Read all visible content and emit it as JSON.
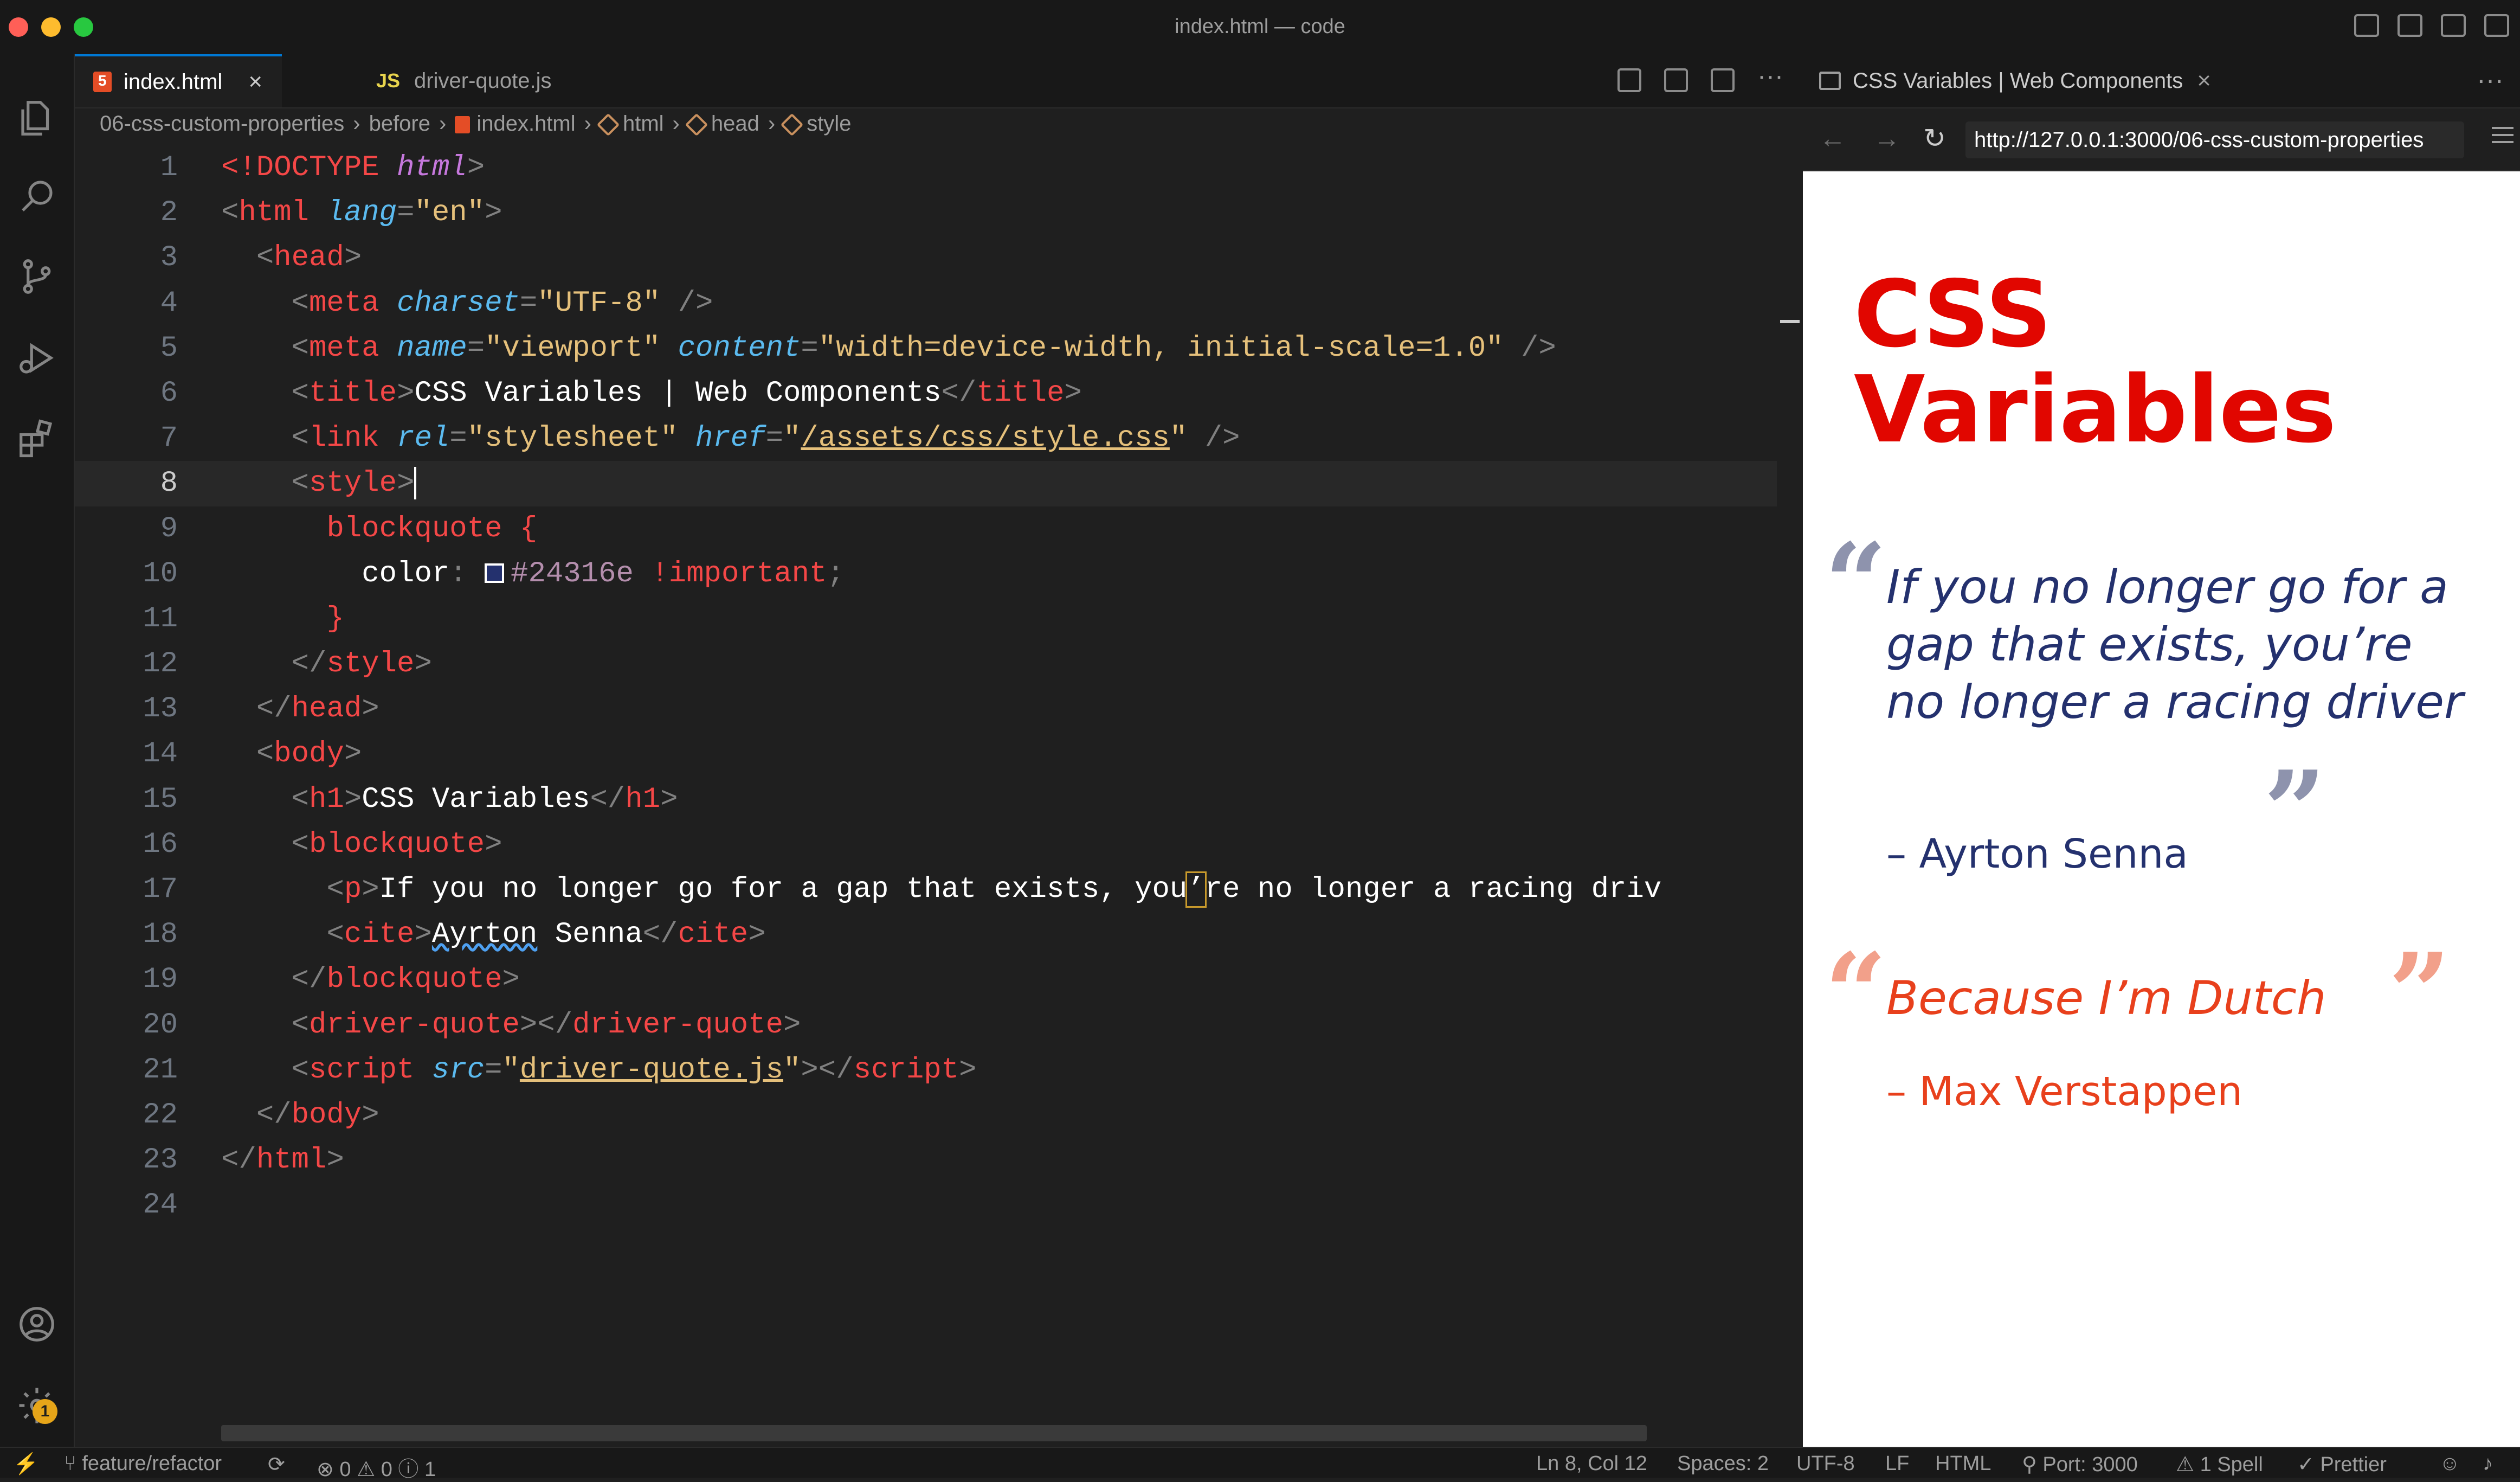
{
  "window": {
    "title": "index.html — code"
  },
  "editor": {
    "tabs": [
      {
        "label": "index.html",
        "type": "html",
        "active": true
      },
      {
        "label": "driver-quote.js",
        "type": "js",
        "icon_text": "JS",
        "active": false
      }
    ],
    "breadcrumb": [
      "06-css-custom-properties",
      "before",
      "index.html",
      "html",
      "head",
      "style"
    ],
    "line_numbers": [
      "1",
      "2",
      "3",
      "4",
      "5",
      "6",
      "7",
      "8",
      "9",
      "10",
      "11",
      "12",
      "13",
      "14",
      "15",
      "16",
      "17",
      "18",
      "19",
      "20",
      "21",
      "22",
      "23",
      "24"
    ],
    "current_line": "8",
    "code": {
      "l1_doctype": "<!DOCTYPE",
      "l1_html": "html",
      "tag_html": "html",
      "attr_lang": "lang",
      "val_en": "\"en\"",
      "tag_head": "head",
      "tag_meta": "meta",
      "attr_charset": "charset",
      "val_utf8": "\"UTF-8\"",
      "attr_name": "name",
      "val_viewport": "\"viewport\"",
      "attr_content": "content",
      "val_content": "\"width=device-width, initial-scale=1.0\"",
      "tag_title": "title",
      "title_text": "CSS Variables | Web Components",
      "tag_link": "link",
      "attr_rel": "rel",
      "val_stylesheet": "\"stylesheet\"",
      "attr_href": "href",
      "val_href": "/assets/css/style.css",
      "tag_style": "style",
      "sel_blockquote": "blockquote",
      "prop_color": "color",
      "color_value": "#24316e",
      "important": "!important",
      "tag_body": "body",
      "tag_h1": "h1",
      "h1_text": "CSS Variables",
      "tag_blockquote": "blockquote",
      "tag_p": "p",
      "p_text_a": "If you no longer go for a gap that exists, you",
      "p_text_apos": "’",
      "p_text_b": "re no longer a racing driv",
      "tag_cite": "cite",
      "cite_text": "Ayrton",
      "cite_text_b": " Senna",
      "tag_driver_quote": "driver-quote",
      "tag_script": "script",
      "attr_src": "src",
      "val_src": "driver-quote.js"
    }
  },
  "browser": {
    "tab_title": "CSS Variables | Web Components",
    "url": "http://127.0.0.1:3000/06-css-custom-properties",
    "page": {
      "heading_line1": "CSS",
      "heading_line2": "Variables",
      "quote1": "If you no longer go for a gap that exists, you’re no longer a racing driver",
      "cite1": "– Ayrton Senna",
      "quote2": "Because I’m Dutch",
      "cite2": "– Max Verstappen",
      "colors": {
        "heading": "#e10600",
        "quote1": "#24316e",
        "quote2": "#e8401c"
      }
    }
  },
  "activity_bar": {
    "settings_badge": "1"
  },
  "statusbar": {
    "branch": "feature/refactor",
    "errors": "0",
    "warnings": "0",
    "info": "1",
    "position": "Ln 8, Col 12",
    "spaces": "Spaces: 2",
    "encoding": "UTF-8",
    "eol": "LF",
    "language": "HTML",
    "port": "Port: 3000",
    "spell": "1 Spell",
    "prettier": "Prettier"
  }
}
